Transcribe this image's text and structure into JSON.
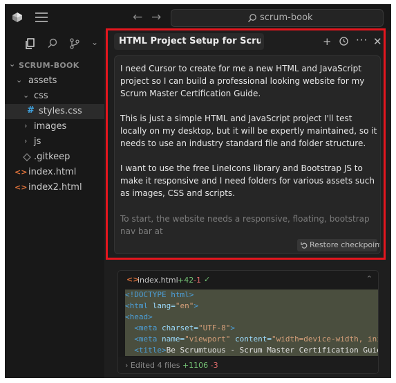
{
  "titlebar": {
    "search_text": "scrum-book"
  },
  "sidebar": {
    "tree_title": "SCRUM-BOOK",
    "items": [
      {
        "label": "assets",
        "chevron": "⌄"
      },
      {
        "label": "css",
        "chevron": "⌄"
      },
      {
        "label": "styles.css",
        "icon": "#"
      },
      {
        "label": "images",
        "chevron": "›"
      },
      {
        "label": "js",
        "chevron": "›"
      },
      {
        "label": ".gitkeep"
      },
      {
        "label": "index.html",
        "icon": "<>"
      },
      {
        "label": "index2.html",
        "icon": "<>"
      }
    ]
  },
  "chat": {
    "tab_title": "HTML Project Setup for Scrum Master",
    "paragraphs": [
      "I need Cursor to create for me a new HTML and JavaScript project so I can build a professional looking website for my Scrum Master Certification Guide.",
      "This is just a simple HTML and JavaScript project I'll test locally on my desktop, but it will be expertly maintained, so it needs to use an industry standard file and folder structure.",
      "I want to use the free LineIcons library and Bootstrap JS to make it responsive and I need folders for various assets such as images, CSS and scripts."
    ],
    "faded_text": "To start, the website needs a responsive, floating, bootstrap nav bar at",
    "restore_label": "Restore checkpoint"
  },
  "code_card": {
    "file_name": "index.html",
    "additions": "+42",
    "deletions": "-1",
    "check": "✓",
    "lines": [
      {
        "t1": "<!DOCTYPE html>"
      },
      {
        "t1": "<html",
        "a": " lang=",
        "s": "\"en\"",
        "t2": ">"
      },
      {
        "t1": "<head>"
      },
      {
        "t1": "  <meta",
        "a": " charset=",
        "s": "\"UTF-8\"",
        "t2": ">"
      },
      {
        "t1": "  <meta",
        "a": " name=",
        "s": "\"viewport\"",
        "a2": " content=",
        "s2": "\"width=device-width, ini"
      },
      {
        "t1": "  <title>",
        "x": "Be Scrumtuous - Scrum Master Certification Guid"
      }
    ],
    "edited_prefix": "Edited 4 files",
    "edited_plus": "+1106",
    "edited_minus": "-3"
  },
  "colors": {
    "highlight_border": "#e4161e",
    "addition": "#74c275",
    "deletion": "#e06c6c",
    "html_icon": "#e0733b",
    "css_icon": "#3fa3e0"
  }
}
